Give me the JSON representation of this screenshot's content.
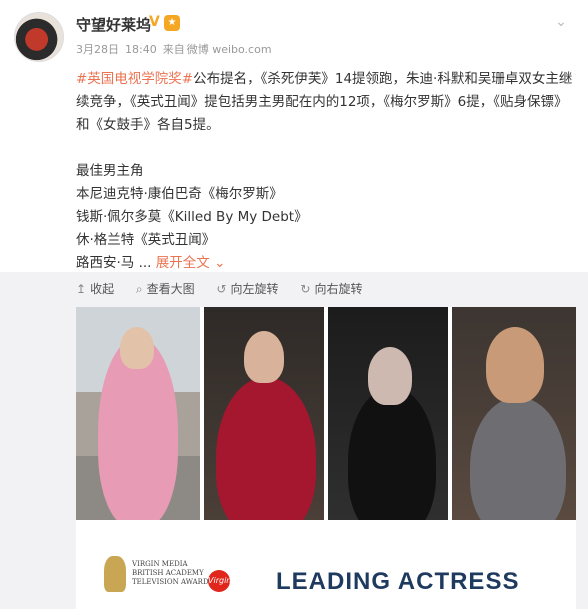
{
  "user": {
    "name": "守望好莱坞",
    "verified_badge": "V",
    "level_badge": "★"
  },
  "meta": {
    "date": "3月28日",
    "time": "18:40",
    "source_prefix": "来自",
    "source": "微博 weibo.com"
  },
  "post": {
    "hashtag": "#英国电视学院奖#",
    "line1_rest": "公布提名，《杀死伊芙》14提领跑，朱迪·科默和吴珊卓双女主继续竞争，《英式丑闻》提包括男主男配在内的12项，《梅尔罗斯》6提，《贴身保镖》和《女鼓手》各自5提。",
    "category": "最佳男主角",
    "nominees": [
      "本尼迪克特·康伯巴奇《梅尔罗斯》",
      "钱斯·佩尔多莫《Killed By My Debt》",
      "休·格兰特《英式丑闻》"
    ],
    "truncated": "路西安·马 ...",
    "expand_label": "展开全文",
    "expand_icon": "chevron-down"
  },
  "toolbar": {
    "collapse": "收起",
    "view_large": "查看大图",
    "rotate_left": "向左旋转",
    "rotate_right": "向右旋转"
  },
  "poster": {
    "org_line1": "VIRGIN MEDIA",
    "org_line2": "BRITISH ACADEMY",
    "org_line3": "TELEVISION AWARDS",
    "sponsor": "Virgin",
    "title": "LEADING ACTRESS"
  },
  "colors": {
    "link": "#eb7350",
    "title": "#1e3a5f",
    "badge": "#f5a623"
  }
}
